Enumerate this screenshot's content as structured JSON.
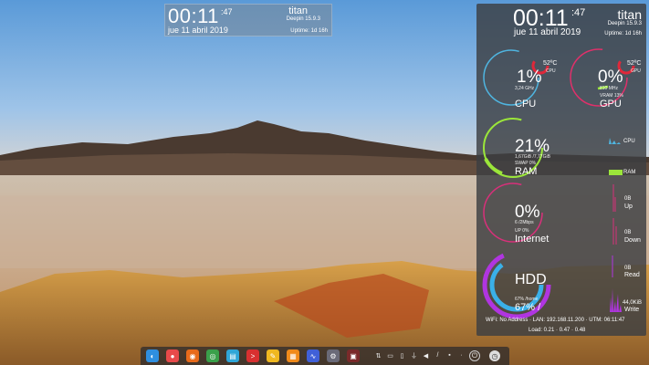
{
  "top_widget": {
    "time": "00:11",
    "seconds": ":47",
    "date": "jue 11 abril 2019",
    "hostname": "titan",
    "os": "Deepin 15.9.3",
    "uptime": "Uptime: 1d 16h"
  },
  "conky": {
    "time": "00:11",
    "seconds": ":47",
    "date": "jue 11 abril 2019",
    "hostname": "titan",
    "os": "Deepin 15.9.3",
    "uptime": "Uptime: 1d 16h",
    "cpu": {
      "percent": "1%",
      "freq": "3,24 GHz",
      "label": "CPU",
      "temp": "52ºC",
      "temp_label": "CPU",
      "usage_fraction": 0.01
    },
    "gpu": {
      "percent": "0%",
      "freq": "810 MHz",
      "vram": "VRAM 13%",
      "label": "GPU",
      "temp": "52ºC",
      "temp_label": "GPU",
      "usage_fraction": 0.0
    },
    "ram": {
      "percent": "21%",
      "detail": "1,67GiB /7,77GiB",
      "swap": "SWAP 0%",
      "label": "RAM",
      "graph_label_cpu": "CPU",
      "graph_label_ram": "RAM",
      "usage_fraction": 0.21
    },
    "internet": {
      "percent": "0%",
      "detail": "6 /2Mbps",
      "up_pct": "UP 0%",
      "label": "Internet",
      "up_value": "0B",
      "up_label": "Up",
      "down_value": "0B",
      "down_label": "Down"
    },
    "hdd": {
      "label": "HDD",
      "home": "67% /home",
      "root": "67% /",
      "read_value": "0B",
      "read_label": "Read",
      "write_value": "44,0KiB",
      "write_label": "Write",
      "home_fraction": 0.67,
      "root_fraction": 0.67
    },
    "footer_network": "WiFi: No Address  ·  LAN: 192.168.11.200  ·  UTM: 06:11:47",
    "footer_load": "Load:  0.21  ·  0.47  ·  0.48"
  },
  "colors": {
    "cpu_ring": "#4fb5e0",
    "temp_ring": "#e0283a",
    "gpu_ring": "#e0306a",
    "ram_ring": "#9be63a",
    "net_ring": "#d8307a",
    "hdd_outer": "#b035e0",
    "hdd_inner": "#3ab0e8"
  },
  "dock": {
    "apps": [
      {
        "name": "launcher-icon",
        "color": "#2f8fe0",
        "glyph": "◐"
      },
      {
        "name": "screen-recorder-icon",
        "color": "#e84a4a",
        "glyph": "●"
      },
      {
        "name": "firefox-icon",
        "color": "#e86a1a",
        "glyph": "◉"
      },
      {
        "name": "chrome-icon",
        "color": "#3aa04a",
        "glyph": "◎"
      },
      {
        "name": "file-manager-icon",
        "color": "#2fa6d8",
        "glyph": "▤"
      },
      {
        "name": "terminal-icon",
        "color": "#d83030",
        "glyph": ">"
      },
      {
        "name": "notes-icon",
        "color": "#f0b820",
        "glyph": "✎"
      },
      {
        "name": "calculator-icon",
        "color": "#f08a1a",
        "glyph": "▦"
      },
      {
        "name": "system-monitor-icon",
        "color": "#4060d8",
        "glyph": "∿"
      },
      {
        "name": "settings-icon",
        "color": "#6a6a78",
        "glyph": "⚙"
      },
      {
        "name": "screenshot-icon",
        "color": "#7a2a2a",
        "glyph": "▣"
      }
    ],
    "tray": [
      {
        "name": "tray-network-icon",
        "glyph": "⇅"
      },
      {
        "name": "tray-keyboard-icon",
        "glyph": "▭"
      },
      {
        "name": "tray-clipboard-icon",
        "glyph": "▯"
      },
      {
        "name": "tray-usb-icon",
        "glyph": "⏚"
      },
      {
        "name": "tray-volume-icon",
        "glyph": "◀"
      },
      {
        "name": "tray-pen-icon",
        "glyph": "/"
      },
      {
        "name": "tray-display-icon",
        "glyph": "▪"
      },
      {
        "name": "tray-shortcut-icon",
        "glyph": "·"
      }
    ]
  }
}
